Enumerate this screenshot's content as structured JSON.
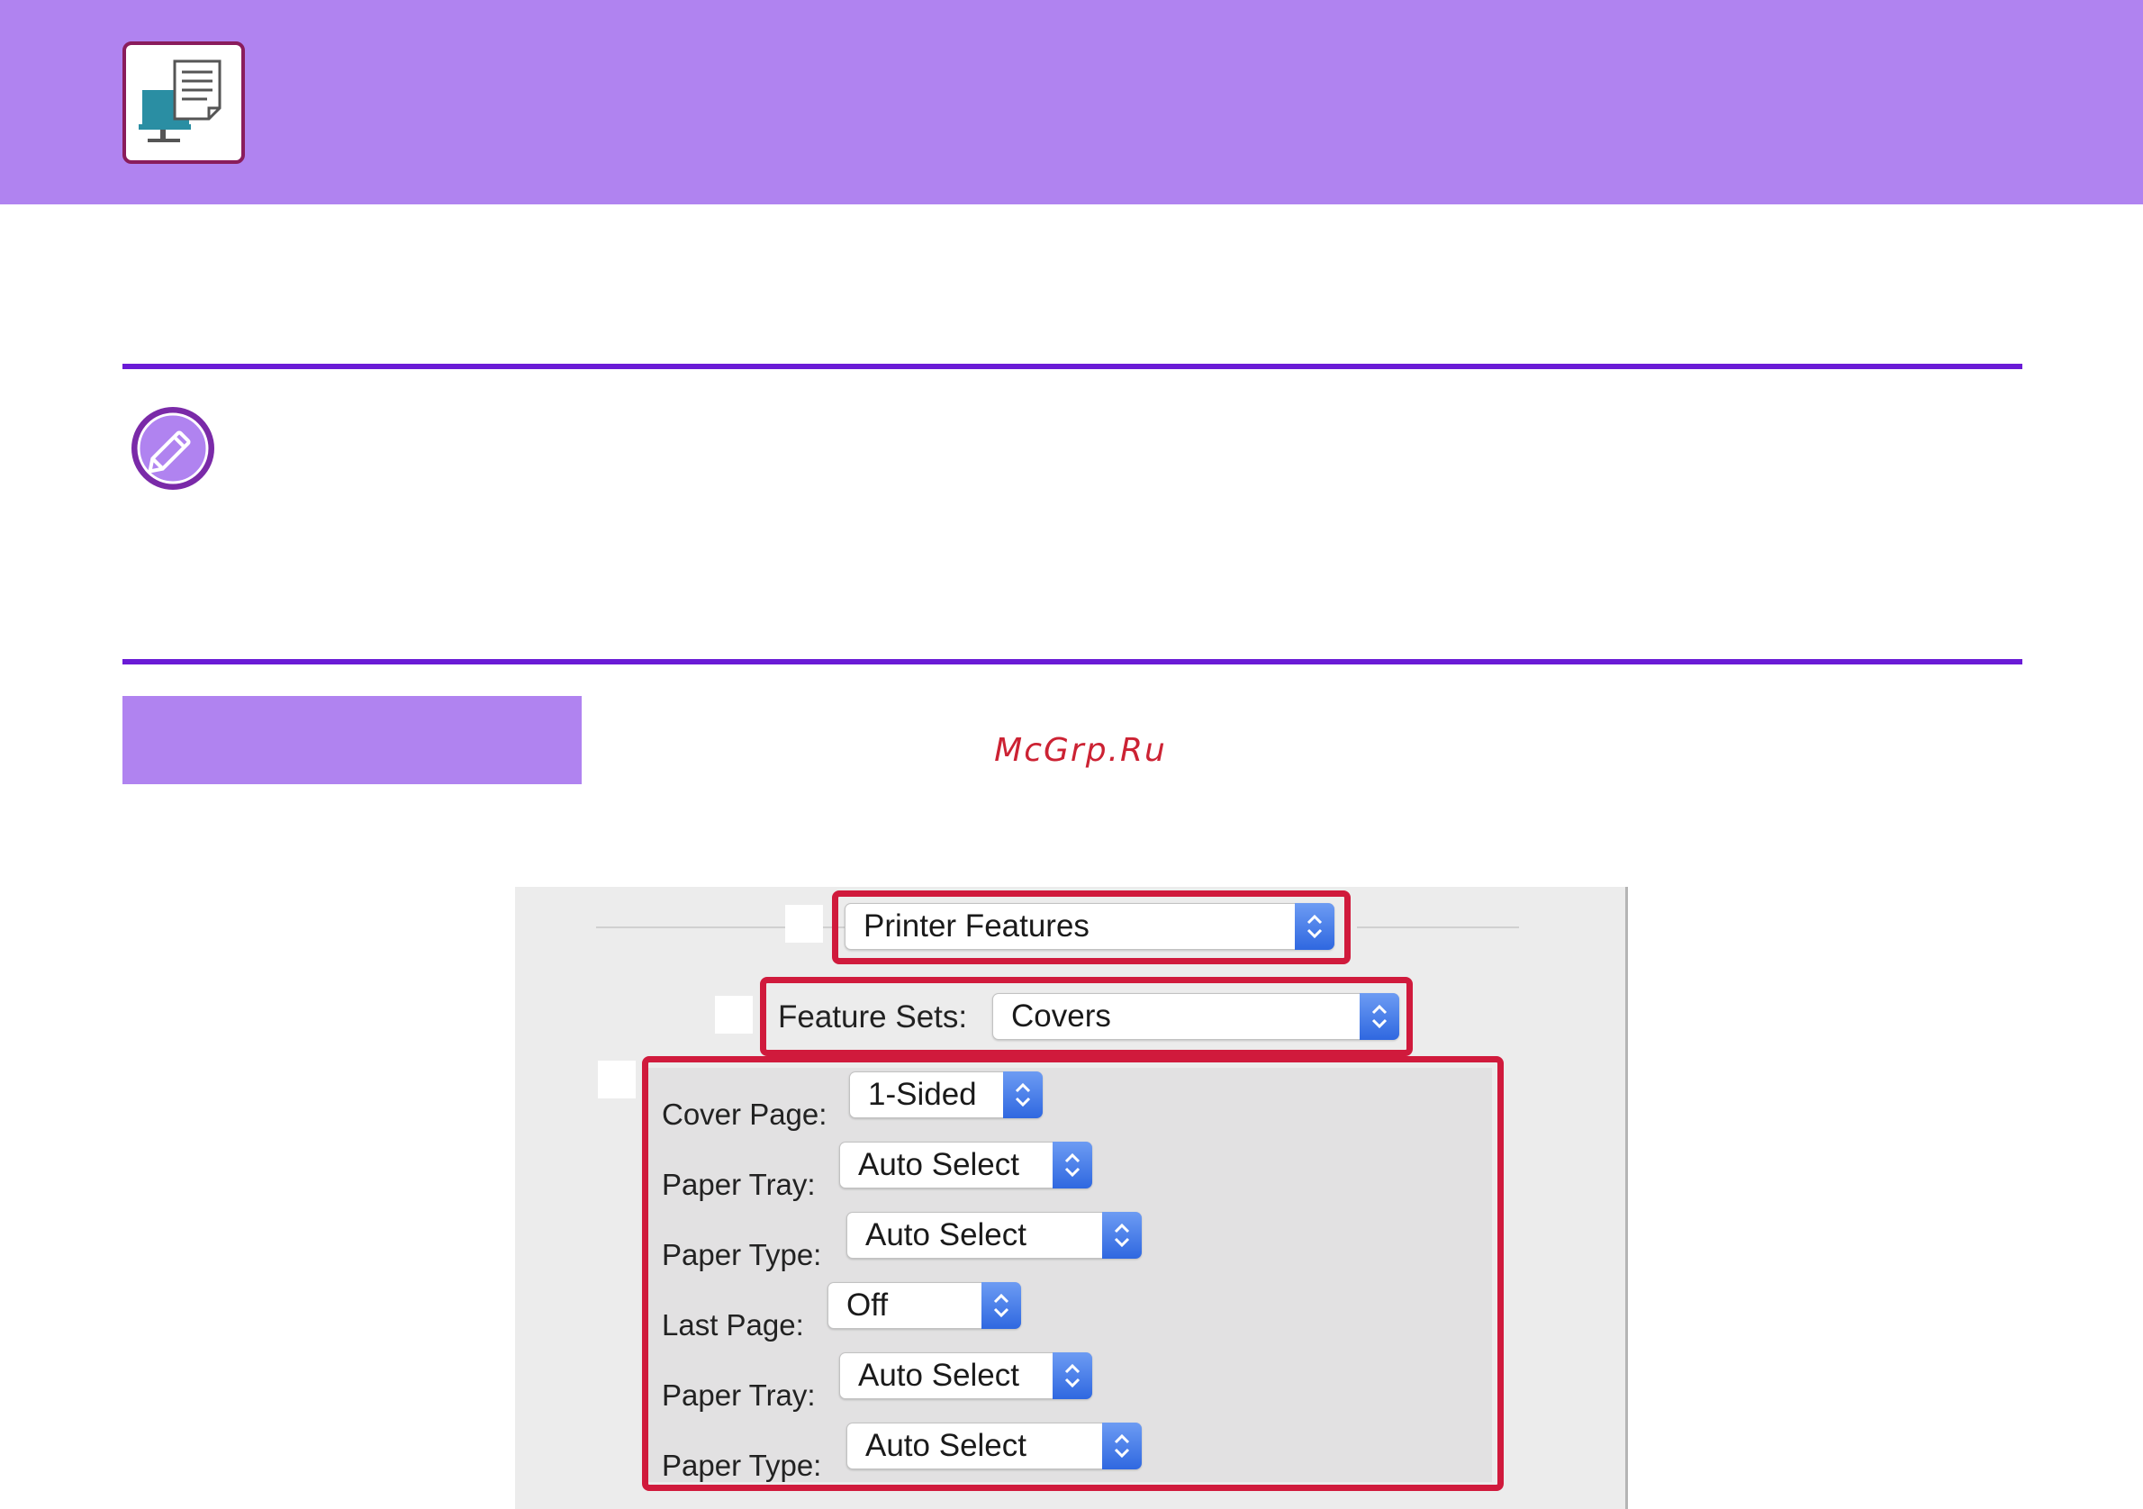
{
  "header": {
    "icon": "print-to-computer-icon",
    "color": "#b083f0"
  },
  "note": {
    "icon": "pencil-note-icon"
  },
  "watermark": "McGrp.Ru",
  "dialog": {
    "menu": {
      "value": "Printer Features"
    },
    "feature_sets": {
      "label": "Feature Sets:",
      "value": "Covers"
    },
    "fields": [
      {
        "label": "Cover Page:",
        "value": "1-Sided"
      },
      {
        "label": "Paper Tray:",
        "value": "Auto Select"
      },
      {
        "label": "Paper Type:",
        "value": "Auto Select"
      },
      {
        "label": "Last Page:",
        "value": "Off"
      },
      {
        "label": "Paper Tray:",
        "value": "Auto Select"
      },
      {
        "label": "Paper Type:",
        "value": "Auto Select"
      }
    ]
  },
  "colors": {
    "accent": "#b083f0",
    "rule": "#6a1bd6",
    "highlight": "#d01a3c"
  }
}
